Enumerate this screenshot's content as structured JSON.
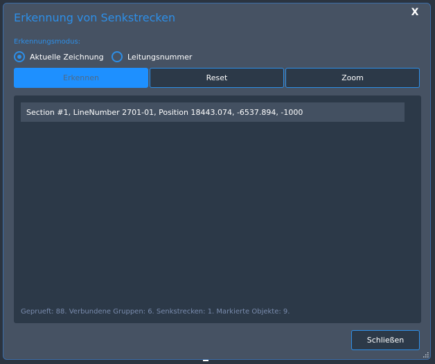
{
  "dialog": {
    "title": "Erkennung von Senkstrecken",
    "close_icon": "close-icon",
    "close_glyph": "X"
  },
  "mode": {
    "label": "Erkennungsmodus:",
    "options": [
      {
        "label": "Aktuelle Zeichnung",
        "checked": true
      },
      {
        "label": "Leitungsnummer",
        "checked": false
      }
    ]
  },
  "toolbar": {
    "detect_label": "Erkennen",
    "reset_label": "Reset",
    "zoom_label": "Zoom"
  },
  "results": {
    "items": [
      "Section #1, LineNumber 2701-01, Position 18443.074, -6537.894, -1000"
    ],
    "status": "Geprueft: 88. Verbundene Gruppen: 6. Senkstrecken: 1. Markierte Objekte: 9."
  },
  "footer": {
    "close_label": "Schließen",
    "resize_icon": "resize-grip-icon"
  },
  "colors": {
    "accent": "#2d8fe8",
    "primary_button": "#1e90ff",
    "dialog_bg": "#465263",
    "panel_bg": "#2c3948",
    "row_bg": "#435061",
    "status_text": "#7a8cae"
  }
}
